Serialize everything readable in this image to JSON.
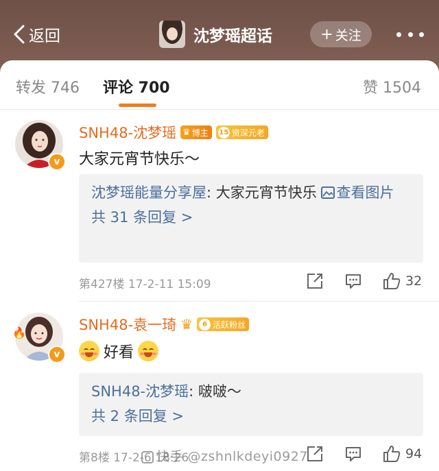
{
  "header": {
    "back_label": "返回",
    "title": "沈梦瑶超话",
    "follow_label": "关注",
    "more_icon": "more-dots-icon",
    "background_color": "#75564b"
  },
  "tabs": [
    {
      "label": "转发 746"
    },
    {
      "label": "评论 700",
      "active": true
    },
    {
      "label": "赞 1504"
    }
  ],
  "accent_color": "#f37c1c",
  "comments": [
    {
      "username": "SNH48-沈梦瑶",
      "badges": [
        "博主",
        "资深元老"
      ],
      "level": "15",
      "text": "大家元宵节快乐～",
      "reply": {
        "user": "沈梦瑶能量分享屋",
        "separator": ": ",
        "body": "大家元宵节快乐 ",
        "link": "查看图片",
        "more": "共 31 条回复 >"
      },
      "meta": "第427楼  17-2-11  15:09",
      "likes": "32"
    },
    {
      "username": "SNH48-袁一琦",
      "badges": [
        "活跃粉丝"
      ],
      "level": "6",
      "text": "好看",
      "reply": {
        "user": "SNH48-沈梦瑶",
        "separator": ": ",
        "body": "啵啵～",
        "more": "共 2 条回复 >"
      },
      "meta": "第8楼  17-2-6  18:26",
      "likes": "94"
    }
  ],
  "watermark": "快手 @zshnlkdeyi0927"
}
